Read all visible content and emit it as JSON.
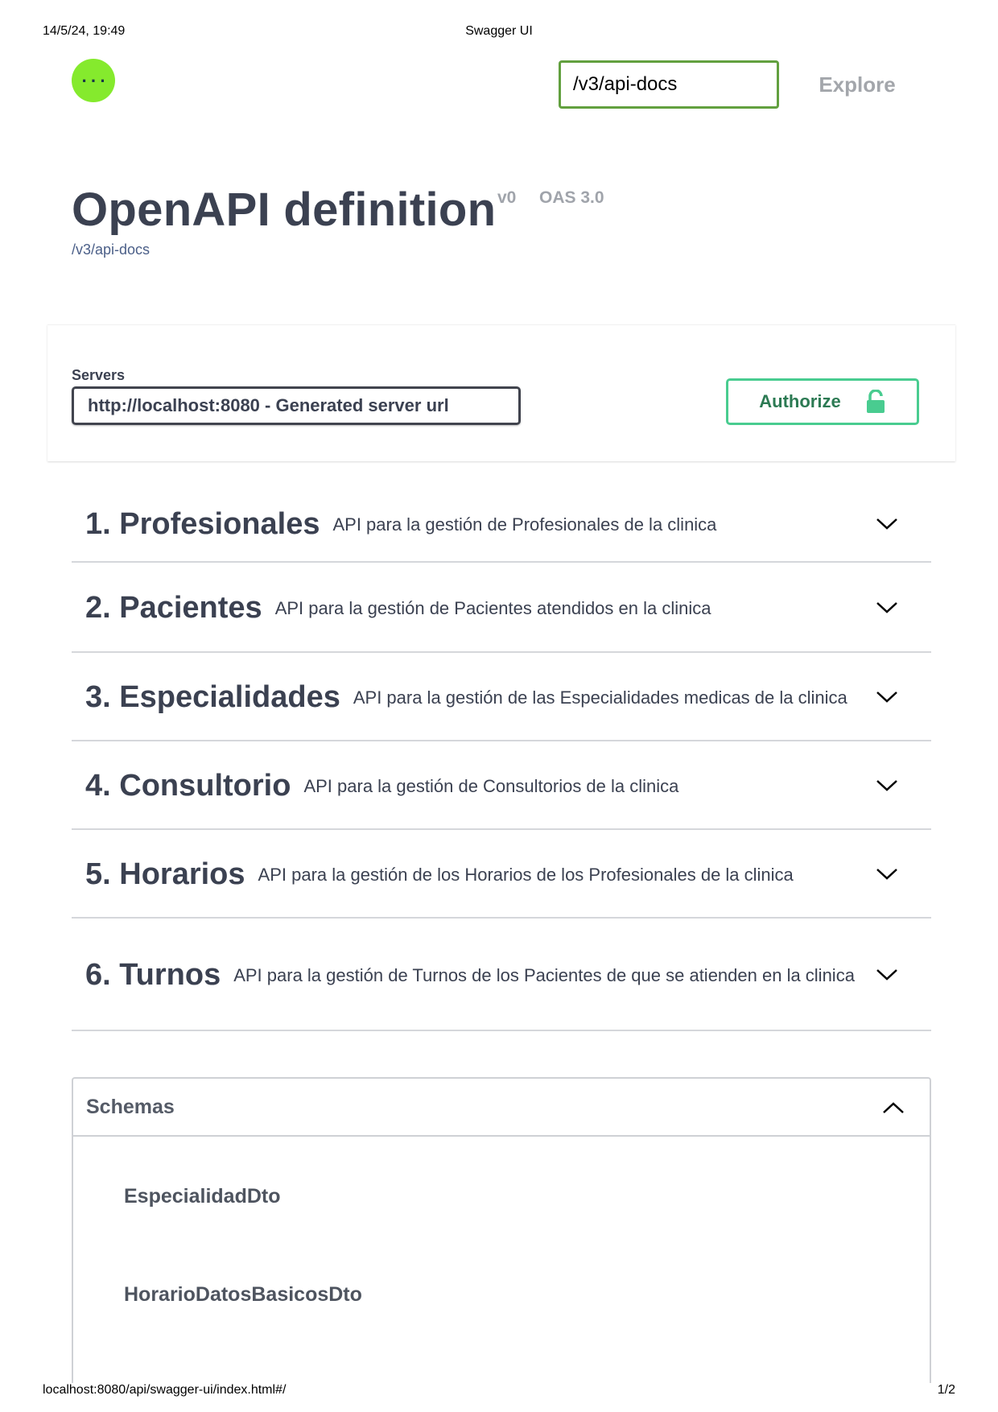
{
  "print": {
    "date": "14/5/24, 19:49",
    "title": "Swagger UI",
    "url": "localhost:8080/api/swagger-ui/index.html#/",
    "page": "1/2"
  },
  "topbar": {
    "logo_icon": "swagger-logo-icon",
    "url_value": "/v3/api-docs",
    "explore_label": "Explore"
  },
  "info": {
    "title": "OpenAPI definition",
    "version": "v0",
    "oas": "OAS 3.0",
    "link": "/v3/api-docs"
  },
  "servers": {
    "label": "Servers",
    "selected": "http://localhost:8080 - Generated server url",
    "authorize_label": "Authorize"
  },
  "tags": [
    {
      "name": "1. Profesionales",
      "description": "API para la gestión de Profesionales de la clinica"
    },
    {
      "name": "2. Pacientes",
      "description": "API para la gestión de Pacientes atendidos en la clinica"
    },
    {
      "name": "3. Especialidades",
      "description": "API para la gestión de las Especialidades medicas de la clinica"
    },
    {
      "name": "4. Consultorio",
      "description": "API para la gestión de Consultorios de la clinica"
    },
    {
      "name": "5. Horarios",
      "description": "API para la gestión de los Horarios de los Profesionales de la clinica"
    },
    {
      "name": "6. Turnos",
      "description": "API para la gestión de Turnos de los Pacientes de que se atienden en la clinica"
    }
  ],
  "schemas": {
    "title": "Schemas",
    "items": [
      "EspecialidadDto",
      "HorarioDatosBasicosDto"
    ]
  },
  "colors": {
    "logo": "#85ea2d",
    "url_border": "#62a03f",
    "authorize": "#49cc90"
  }
}
